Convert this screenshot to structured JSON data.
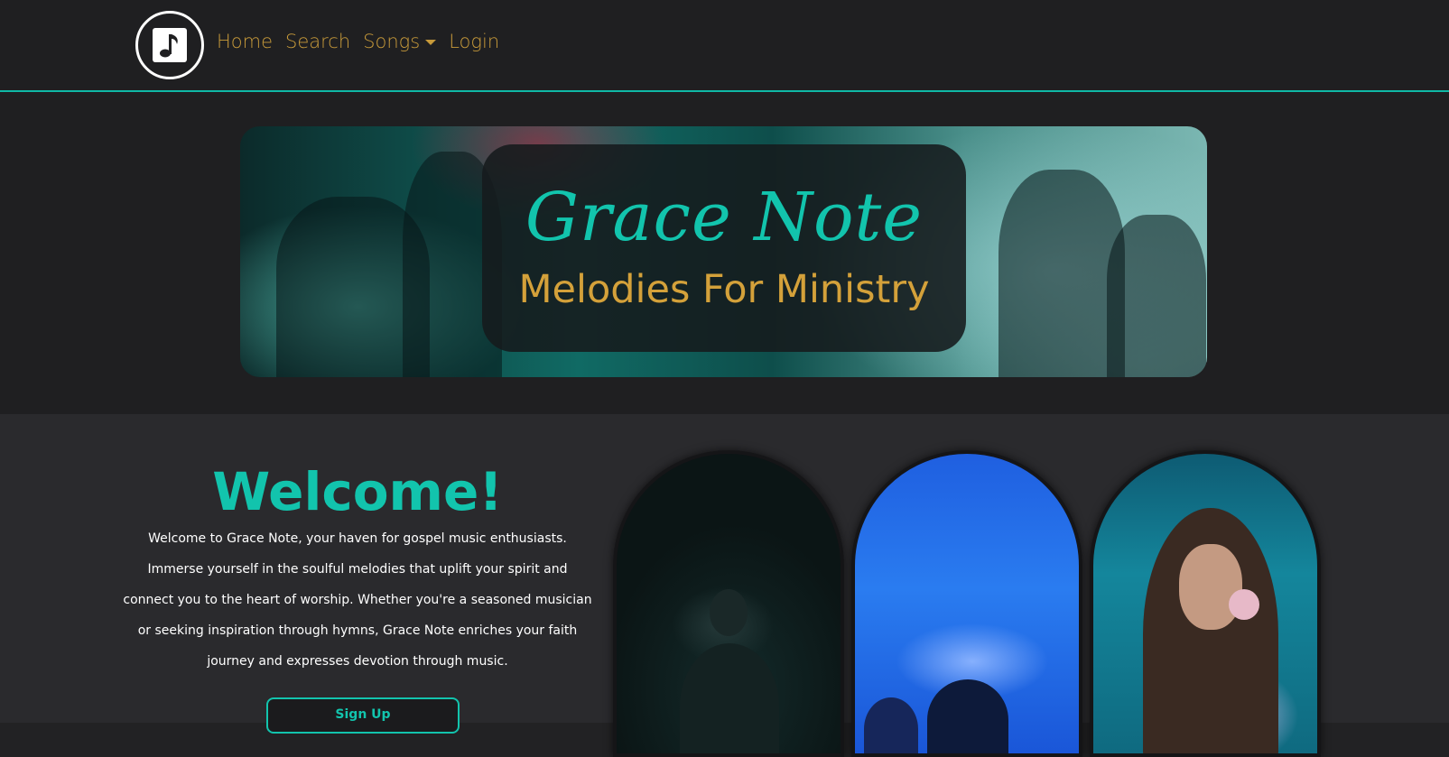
{
  "nav": {
    "logo_icon": "music-note-icon",
    "links": [
      {
        "label": "Home"
      },
      {
        "label": "Search"
      },
      {
        "label": "Songs",
        "dropdown": true
      },
      {
        "label": "Login"
      }
    ]
  },
  "hero": {
    "title": "Grace Note",
    "subtitle": "Melodies For Ministry"
  },
  "welcome": {
    "title": "Welcome!",
    "text": "Welcome to Grace Note, your haven for gospel music enthusiasts. Immerse yourself in the soulful melodies that uplift your spirit and connect you to the heart of worship. Whether you're a seasoned musician or seeking inspiration through hymns, Grace Note enriches your faith journey and expresses devotion through music.",
    "signup_label": "Sign Up"
  },
  "colors": {
    "accent": "#12c4ad",
    "nav_link": "#c79a3a",
    "gold": "#d4a13a",
    "background": "#222224"
  }
}
